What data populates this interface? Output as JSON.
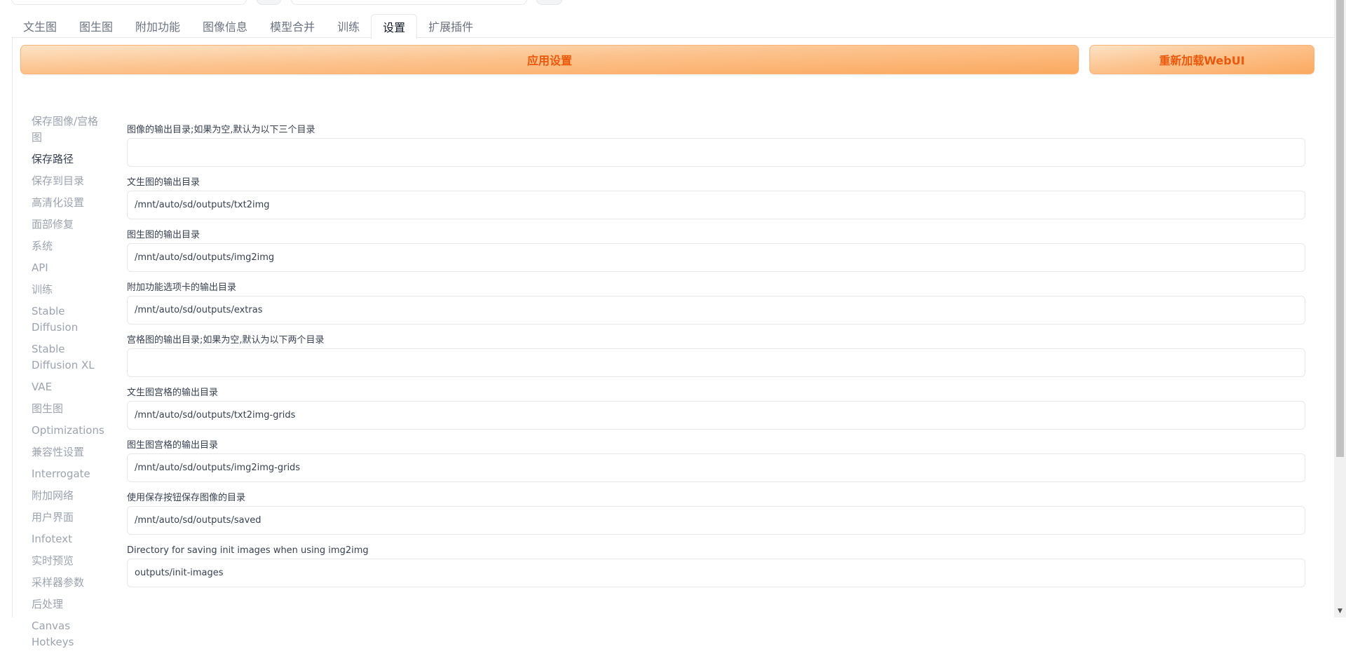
{
  "tabs": [
    "文生图",
    "图生图",
    "附加功能",
    "图像信息",
    "模型合并",
    "训练",
    "设置",
    "扩展插件"
  ],
  "active_tab_index": 6,
  "buttons": {
    "apply": "应用设置",
    "reload": "重新加载WebUI"
  },
  "sidebar": {
    "active_index": 1,
    "items": [
      "保存图像/宫格图",
      "保存路径",
      "保存到目录",
      "高清化设置",
      "面部修复",
      "系统",
      "API",
      "训练",
      "Stable Diffusion",
      "Stable Diffusion XL",
      "VAE",
      "图生图",
      "Optimizations",
      "兼容性设置",
      "Interrogate",
      "附加网络",
      "用户界面",
      "Infotext",
      "实时预览",
      "采样器参数",
      "后处理",
      "Canvas Hotkeys"
    ]
  },
  "fields": [
    {
      "label": "图像的输出目录;如果为空,默认为以下三个目录",
      "value": ""
    },
    {
      "label": "文生图的输出目录",
      "value": "/mnt/auto/sd/outputs/txt2img"
    },
    {
      "label": "图生图的输出目录",
      "value": "/mnt/auto/sd/outputs/img2img"
    },
    {
      "label": "附加功能选项卡的输出目录",
      "value": "/mnt/auto/sd/outputs/extras"
    },
    {
      "label": "宫格图的输出目录;如果为空,默认为以下两个目录",
      "value": ""
    },
    {
      "label": "文生图宫格的输出目录",
      "value": "/mnt/auto/sd/outputs/txt2img-grids"
    },
    {
      "label": "图生图宫格的输出目录",
      "value": "/mnt/auto/sd/outputs/img2img-grids"
    },
    {
      "label": "使用保存按钮保存图像的目录",
      "value": "/mnt/auto/sd/outputs/saved"
    },
    {
      "label": "Directory for saving init images when using img2img",
      "value": "outputs/init-images"
    }
  ],
  "colors": {
    "accent": "#ea580c",
    "button_gradient_start": "#fde3c6",
    "button_gradient_end": "#fba95f"
  },
  "scrollbar": {
    "down_arrow_icon": "triangle-down",
    "scroll_position_fraction": 0.0
  }
}
